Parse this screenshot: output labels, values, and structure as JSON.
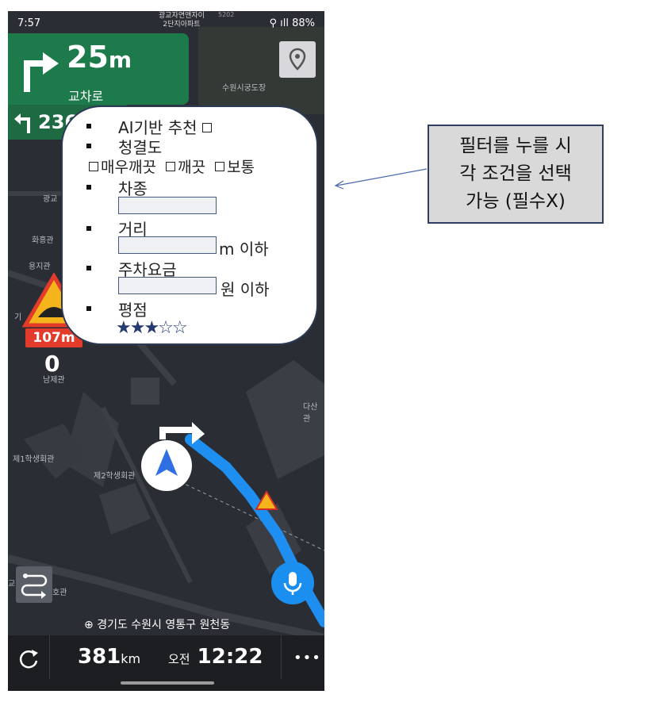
{
  "status_bar": {
    "time": "7:57",
    "location_line1": "광교자연앤자이",
    "location_line2": "2단지아파트",
    "code": "5202",
    "battery": "88%"
  },
  "guidance": {
    "distance_value": "25",
    "distance_unit": "m",
    "road_name": "교차로",
    "next_distance": "236"
  },
  "map_labels": {
    "poi_top": "수원시궁도장",
    "gwanggyo": "광교",
    "hwahonggwan": "화흥관",
    "yongjigwan": "용지관",
    "gi": "기",
    "namjegwan": "남제관",
    "je1": "제1학생회관",
    "je2": "제2학생회관",
    "dasan": "다산관",
    "hogwan": "호관",
    "gyo": "교"
  },
  "warning": {
    "sign_distance": "107m",
    "speed": "0"
  },
  "address": "경기도 수원시 영통구 원천동",
  "bottom_bar": {
    "remaining_value": "381",
    "remaining_unit": "km",
    "ampm": "오전",
    "arrival_time": "12:22",
    "more": "•••"
  },
  "filter_panel": {
    "ai_label": "AI기반 추천",
    "cleanliness_label": "청결도",
    "clean_opt1": "매우깨끗",
    "clean_opt2": "깨끗",
    "clean_opt3": "보통",
    "car_type_label": "차종",
    "distance_label": "거리",
    "distance_suffix": "m 이하",
    "fee_label": "주차요금",
    "fee_suffix": "원 이하",
    "rating_label": "평점",
    "rating_stars": "★★★☆☆",
    "rating_value": 3,
    "rating_max": 5
  },
  "callout": {
    "line1": "필터를 누를 시",
    "line2": "각 조건을 선택",
    "line3": "가능 (필수X)"
  },
  "colors": {
    "map_bg": "#2a2d33",
    "guidance_green": "#1d7a4b",
    "route_blue": "#1e8ff0",
    "warning_red": "#e23b2c",
    "mic_blue": "#1a8ff0"
  }
}
